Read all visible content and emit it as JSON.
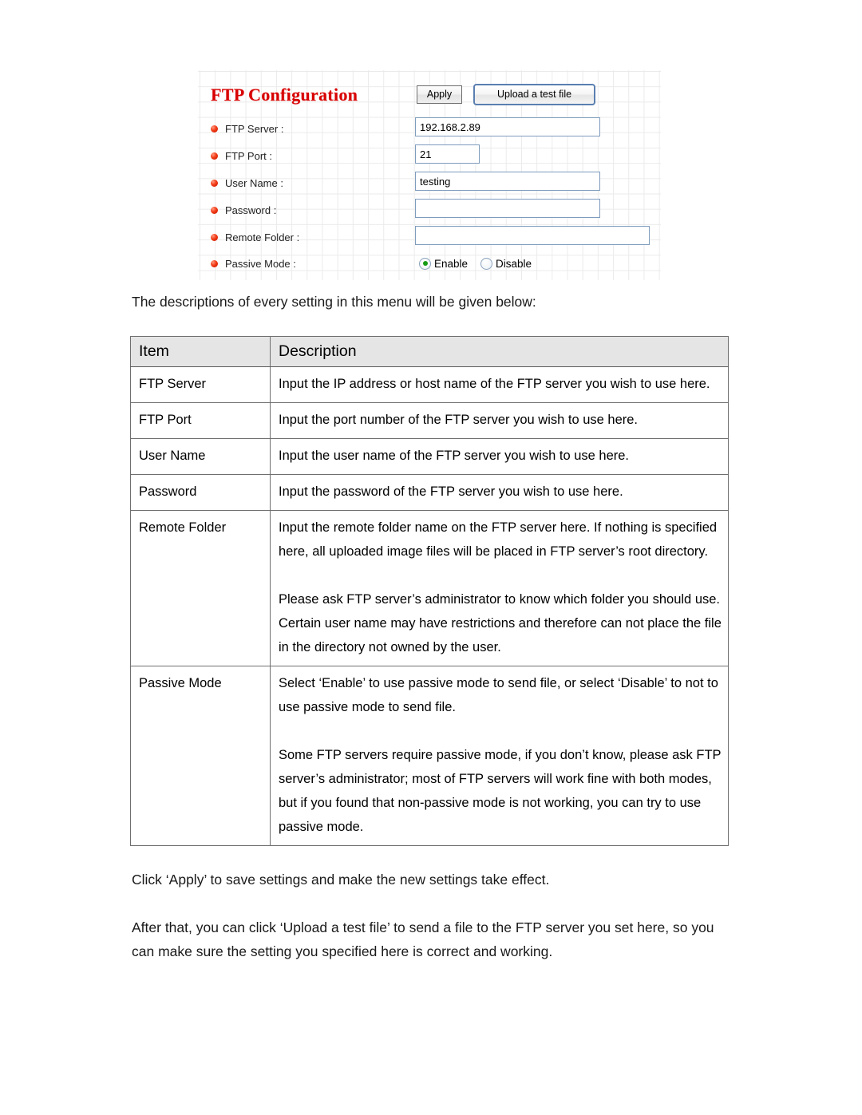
{
  "screenshot_panel": {
    "title": "FTP Configuration",
    "buttons": {
      "apply": "Apply",
      "upload_test_file": "Upload a test file"
    },
    "fields": [
      {
        "label": "FTP Server :",
        "value": "192.168.2.89",
        "placeholder": ""
      },
      {
        "label": "FTP Port :",
        "value": "21",
        "placeholder": ""
      },
      {
        "label": "User Name :",
        "value": "testing",
        "placeholder": ""
      },
      {
        "label": "Password :",
        "value": "",
        "placeholder": ""
      },
      {
        "label": "Remote Folder :",
        "value": "",
        "placeholder": ""
      }
    ],
    "passive_mode": {
      "label": "Passive Mode :",
      "options": [
        "Enable",
        "Disable"
      ],
      "selected": "Enable"
    },
    "colors": {
      "title_red": "#d80000",
      "bullet_red": "#f23b16",
      "input_border": "#7e9cbd",
      "radio_selected_green": "#169b16"
    }
  },
  "intro_paragraph": "The descriptions of every setting in this menu will be given below:",
  "table": {
    "headers": {
      "item": "Item",
      "description": "Description"
    },
    "rows": [
      {
        "item": "FTP Server",
        "paragraphs": [
          "Input the IP address or host name of the FTP server you wish to use here."
        ]
      },
      {
        "item": "FTP Port",
        "paragraphs": [
          "Input the port number of the FTP server you wish to use here."
        ]
      },
      {
        "item": "User Name",
        "paragraphs": [
          "Input the user name of the FTP server you wish to use here."
        ]
      },
      {
        "item": "Password",
        "paragraphs": [
          "Input the password of the FTP server you wish to use here."
        ]
      },
      {
        "item": "Remote Folder",
        "paragraphs": [
          "Input the remote folder name on the FTP server here. If nothing is specified here, all uploaded image files will be placed in FTP server’s root directory.",
          "Please ask FTP server’s administrator to know which folder you should use. Certain user name may have restrictions and therefore can not place the file in the directory not owned by the user."
        ]
      },
      {
        "item": "Passive Mode",
        "paragraphs": [
          "Select ‘Enable’ to use passive mode to send file, or select ‘Disable’ to not to use passive mode to send file.",
          "Some FTP servers require passive mode, if you don’t know, please ask FTP server’s administrator; most of FTP servers will work fine with both modes, but if you found that non-passive mode is not working, you can try to use passive mode."
        ]
      }
    ]
  },
  "closing_paragraphs": {
    "apply_note": "Click ‘Apply’ to save settings and make the new settings take effect.",
    "upload_note": "After that, you can click ‘Upload a test file’ to send a file to the FTP server you set here, so you can make sure the setting you specified here is correct and working."
  }
}
